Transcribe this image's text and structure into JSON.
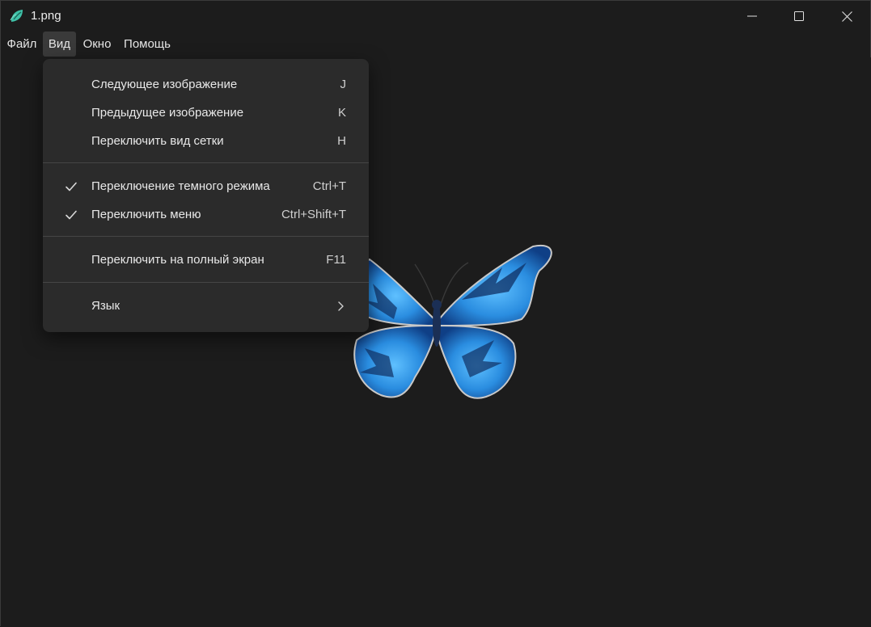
{
  "window": {
    "title": "1.png",
    "app_icon": "leaf-icon",
    "controls": {
      "minimize": "minimize-icon",
      "maximize": "maximize-icon",
      "close": "close-icon"
    }
  },
  "menubar": {
    "items": [
      {
        "label": "Файл"
      },
      {
        "label": "Вид",
        "active": true
      },
      {
        "label": "Окно"
      },
      {
        "label": "Помощь"
      }
    ]
  },
  "view_menu": {
    "items": [
      {
        "label": "Следующее изображение",
        "shortcut": "J"
      },
      {
        "label": "Предыдущее изображение",
        "shortcut": "K"
      },
      {
        "label": "Переключить вид сетки",
        "shortcut": "H"
      },
      {
        "label": "Переключение темного режима",
        "shortcut": "Ctrl+T",
        "checked": true
      },
      {
        "label": "Переключить меню",
        "shortcut": "Ctrl+Shift+T",
        "checked": true
      },
      {
        "label": "Переключить на полный экран",
        "shortcut": "F11"
      },
      {
        "label": "Язык",
        "submenu": true,
        "icon": "chevron-right-icon"
      }
    ]
  },
  "colors": {
    "background": "#1c1c1c",
    "menu_background": "#2b2b2b",
    "butterfly_primary": "#2a8de0",
    "butterfly_dark": "#0f2f63"
  }
}
